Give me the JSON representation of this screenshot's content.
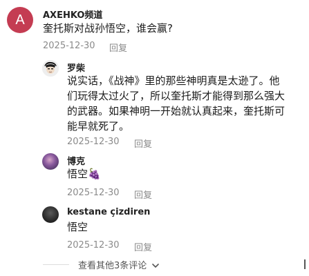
{
  "comment": {
    "avatar_letter": "A",
    "avatar_color": "#c43c52",
    "username": "AXEHKO频道",
    "text": "奎托斯对战孙悟空，谁会赢?",
    "date": "2025-12-30",
    "reply_label": "回复"
  },
  "replies": [
    {
      "username": "罗柴",
      "text_lines": [
        "说实话，《战神》里的那些神明真是太逊了。他",
        "们玩得太过火了，所以奎托斯才能得到那么强大",
        "的武器。如果神明一开始就认真起来，奎托斯可",
        "能早就死了。"
      ],
      "date": "2025-12-30",
      "reply_label": "回复"
    },
    {
      "username": "博克",
      "text": "悟空",
      "emoji": "🍇",
      "date": "2025-12-30",
      "reply_label": "回复"
    },
    {
      "username": "kestane çizdiren",
      "text": "悟空",
      "date": "2025-12-30",
      "reply_label": "回复"
    }
  ],
  "more_replies": {
    "label": "查看其他3条评论",
    "icon": "chevron-down-icon"
  }
}
